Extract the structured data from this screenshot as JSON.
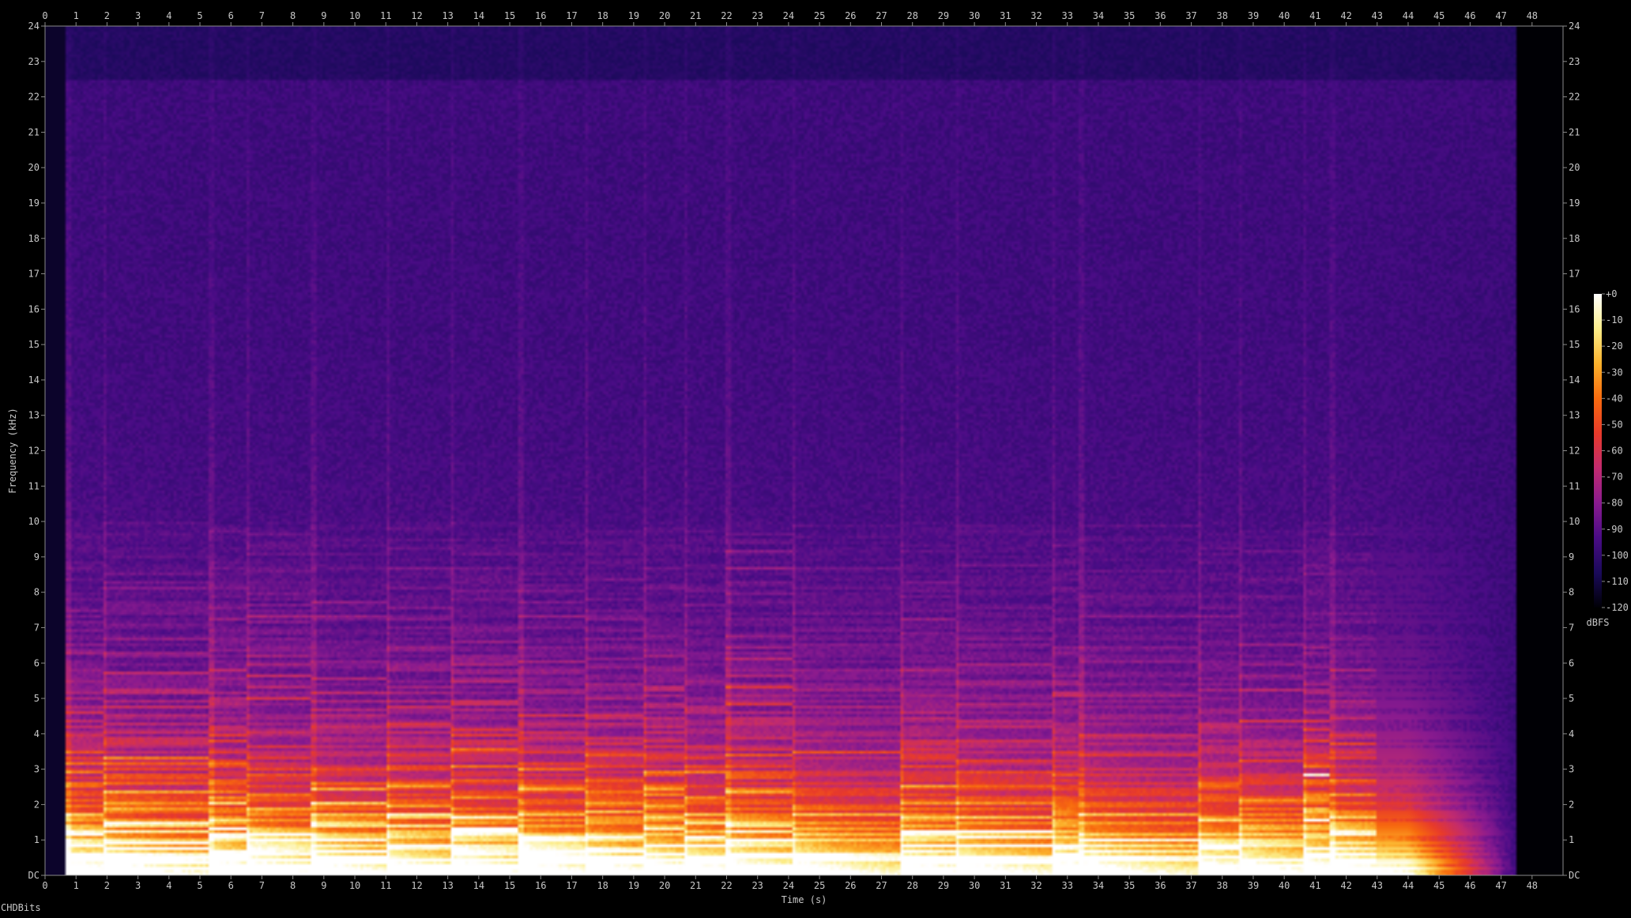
{
  "chart_data": {
    "type": "heatmap",
    "title": "",
    "xlabel": "Time (s)",
    "ylabel": "Frequency (kHz)",
    "xlim": [
      0,
      49
    ],
    "ylim": [
      0,
      24
    ],
    "x_ticks": [
      "0",
      "1",
      "2",
      "3",
      "4",
      "5",
      "6",
      "7",
      "8",
      "9",
      "10",
      "11",
      "12",
      "13",
      "14",
      "15",
      "16",
      "17",
      "18",
      "19",
      "20",
      "21",
      "22",
      "23",
      "24",
      "25",
      "26",
      "27",
      "28",
      "29",
      "30",
      "31",
      "32",
      "33",
      "34",
      "35",
      "36",
      "37",
      "38",
      "39",
      "40",
      "41",
      "42",
      "43",
      "44",
      "45",
      "46",
      "47",
      "48"
    ],
    "y_ticks": [
      "DC",
      "1",
      "2",
      "3",
      "4",
      "5",
      "6",
      "7",
      "8",
      "9",
      "10",
      "11",
      "12",
      "13",
      "14",
      "15",
      "16",
      "17",
      "18",
      "19",
      "20",
      "21",
      "22",
      "23",
      "24"
    ],
    "colorbar": {
      "label": "dBFS",
      "ticks": [
        "+0",
        "-10",
        "-20",
        "-30",
        "-40",
        "-50",
        "-60",
        "-70",
        "-80",
        "-90",
        "-100",
        "-110",
        "-120"
      ],
      "range": [
        -120,
        0
      ],
      "colormap": [
        "#000005",
        "#1a0a5a",
        "#4a0c86",
        "#8a1b8f",
        "#c22b6f",
        "#e83a2a",
        "#f86b0e",
        "#fcb22c",
        "#fcee8a",
        "#ffffff"
      ]
    },
    "audio_start_s": 0.7,
    "audio_end_s": 47.5,
    "onsets_s": [
      0.7,
      1.9,
      5.3,
      6.5,
      8.6,
      11.0,
      13.1,
      15.3,
      17.4,
      19.3,
      20.6,
      22.0,
      24.1,
      27.6,
      29.4,
      32.5,
      33.4,
      37.2,
      38.5,
      40.6,
      41.5
    ]
  },
  "footer": {
    "text": "CHDBits"
  }
}
